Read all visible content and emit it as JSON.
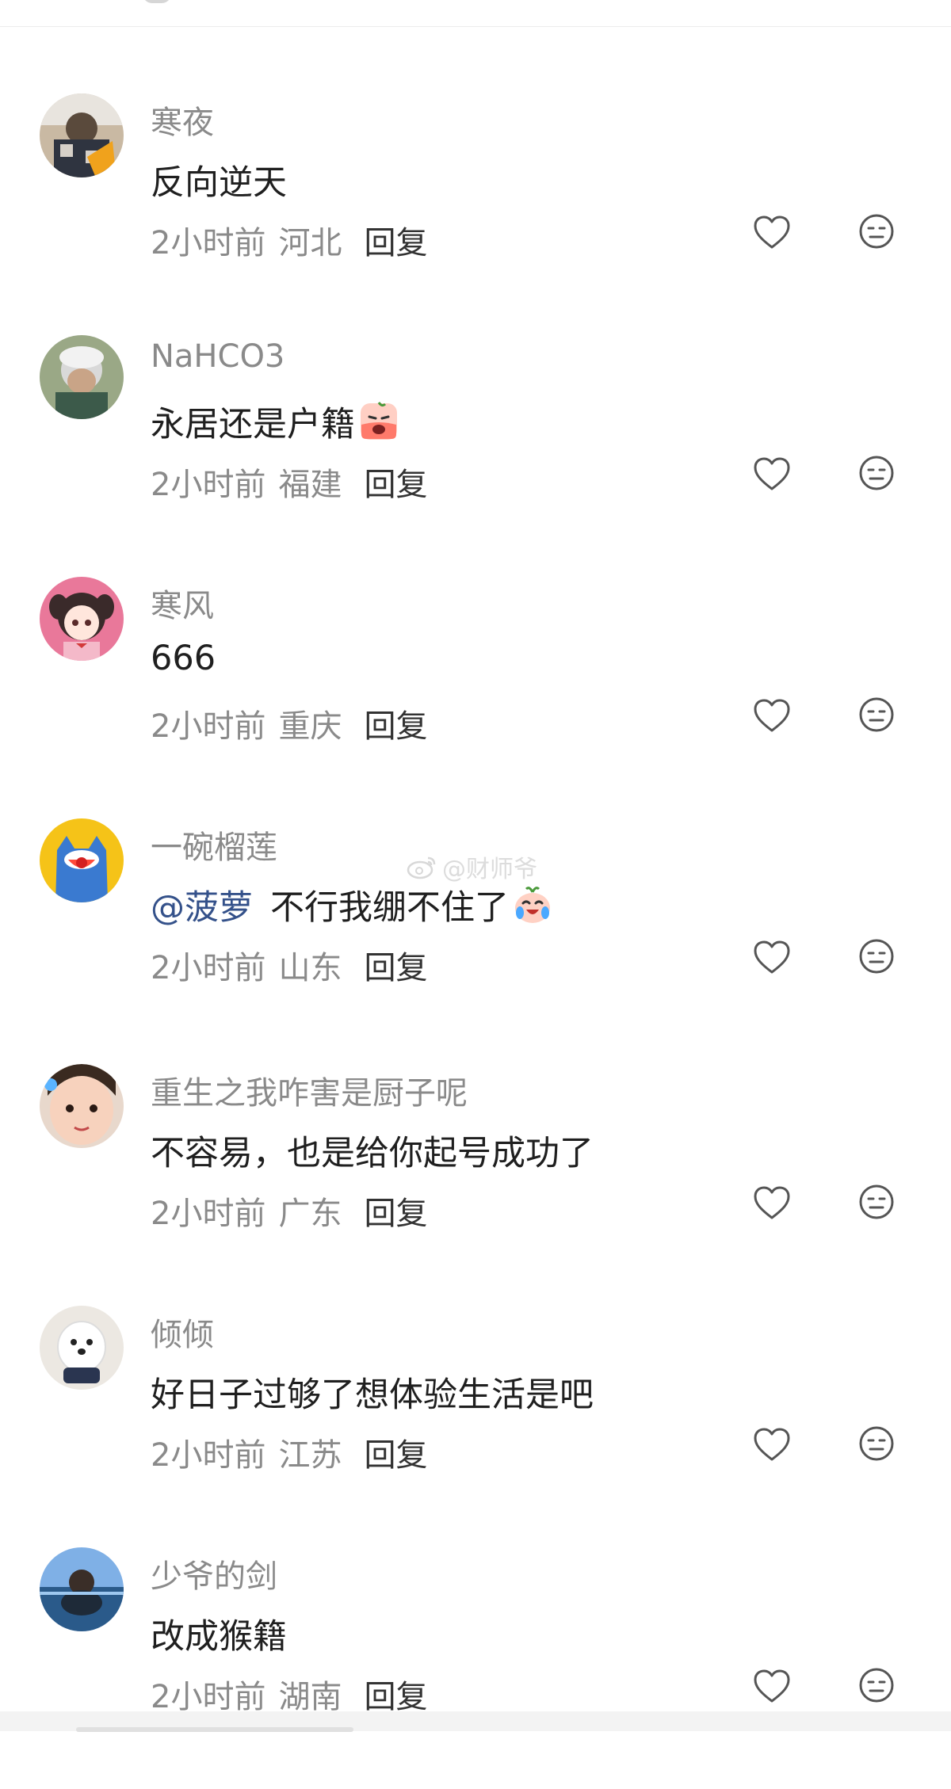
{
  "watermark": {
    "text": "@财师爷",
    "icon": "weibo-icon"
  },
  "icons": {
    "like": "heart-outline-icon",
    "dislike": "neutral-face-icon"
  },
  "colors": {
    "username": "#8a8a8a",
    "meta": "#8a8a8a",
    "reply": "#333333",
    "mention": "#34518a",
    "text": "#1f1f1f"
  },
  "comments": [
    {
      "username": "寒夜",
      "text": "反向逆天",
      "time": "2小时前",
      "location": "河北",
      "reply": "回复",
      "avatar": "avatar-photo"
    },
    {
      "username": "NaHCO3",
      "text": "永居还是户籍",
      "emoji": "crying-emoji-icon",
      "time": "2小时前",
      "location": "福建",
      "reply": "回复",
      "avatar": "avatar-photo"
    },
    {
      "username": "寒风",
      "text": "666",
      "time": "2小时前",
      "location": "重庆",
      "reply": "回复",
      "avatar": "avatar-anime-girl"
    },
    {
      "username": "一碗榴莲",
      "mention": "@菠萝",
      "text": "不行我绷不住了",
      "emoji": "laughing-crying-emoji-icon",
      "time": "2小时前",
      "location": "山东",
      "reply": "回复",
      "avatar": "avatar-cartoon-cat"
    },
    {
      "username": "重生之我咋害是厨子呢",
      "text": "不容易，也是给你起号成功了",
      "time": "2小时前",
      "location": "广东",
      "reply": "回复",
      "avatar": "avatar-child-photo"
    },
    {
      "username": "倾倾",
      "text": "好日子过够了想体验生活是吧",
      "time": "2小时前",
      "location": "江苏",
      "reply": "回复",
      "avatar": "avatar-dog-photo"
    },
    {
      "username": "少爷的剑",
      "text": "改成猴籍",
      "time": "2小时前",
      "location": "湖南",
      "reply": "回复",
      "avatar": "avatar-sea-photo"
    }
  ]
}
